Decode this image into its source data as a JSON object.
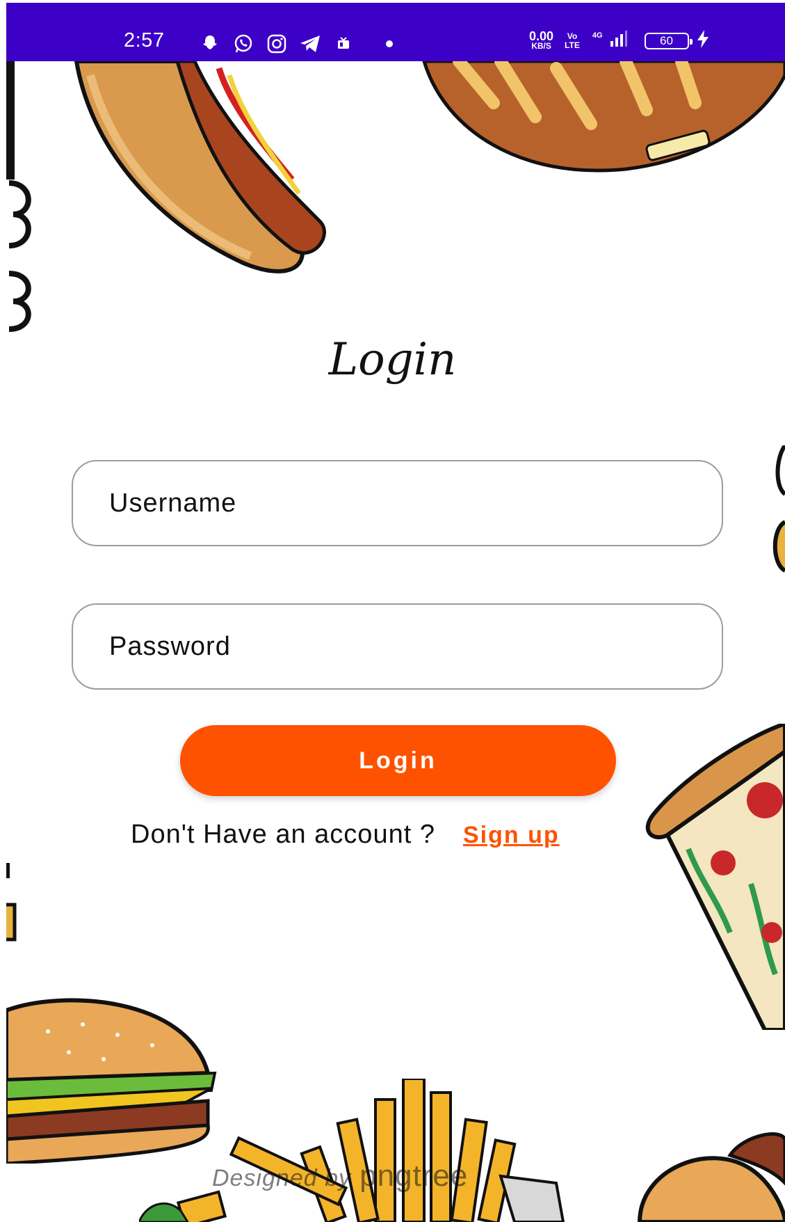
{
  "status_bar": {
    "time": "2:57",
    "icons": [
      "snapchat-icon",
      "whatsapp-icon",
      "instagram-icon",
      "telegram-icon",
      "notification-icon",
      "dot-icon"
    ],
    "net_speed_value": "0.00",
    "net_speed_unit": "KB/S",
    "volte_top": "Vo",
    "volte_bottom": "LTE",
    "network_type": "4G",
    "battery": "60",
    "bg_color": "#3d00c6"
  },
  "screen": {
    "title": "Login",
    "username_placeholder": "Username",
    "password_placeholder": "Password",
    "login_button": "Login",
    "signup_prompt": "Don't Have an account ?",
    "signup_link": "Sign up",
    "accent_color": "#fe5200"
  },
  "background": {
    "watermark_prefix": "Designed by",
    "watermark_brand": "pngtree"
  }
}
